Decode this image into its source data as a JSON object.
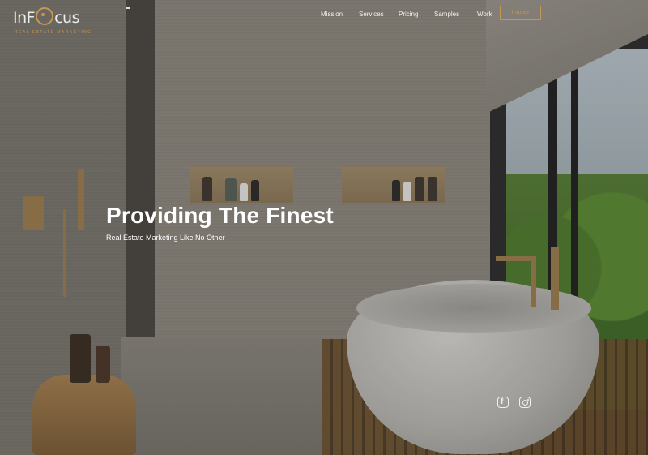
{
  "logo": {
    "name": "InFocus",
    "name_before": "InF",
    "name_after": "cus",
    "tagline": "REAL ESTATE MARKETING",
    "accent_color": "#c49752"
  },
  "nav": {
    "items": [
      {
        "label": "Mission"
      },
      {
        "label": "Services"
      },
      {
        "label": "Pricing"
      },
      {
        "label": "Samples"
      },
      {
        "label": "Work"
      }
    ],
    "cta_label": "Inquire"
  },
  "hero": {
    "headline": "Providing The Finest",
    "subheadline": "Real Estate Marketing Like No Other"
  },
  "social": {
    "icons": [
      "facebook-icon",
      "instagram-icon"
    ]
  }
}
